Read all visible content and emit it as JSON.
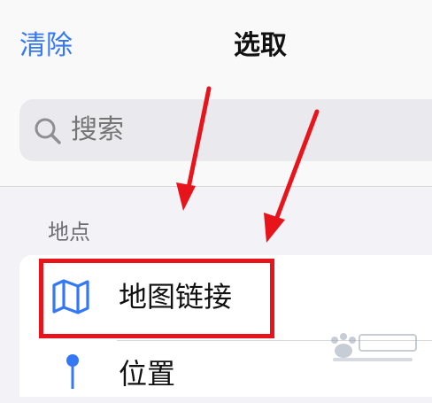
{
  "header": {
    "clear_label": "清除",
    "title": "选取"
  },
  "search": {
    "placeholder": "搜索"
  },
  "section": {
    "title": "地点"
  },
  "list": {
    "items": [
      {
        "label": "地图链接",
        "icon": "map-icon"
      },
      {
        "label": "位置",
        "icon": "location-pin-icon"
      }
    ]
  },
  "annotations": {
    "highlight_color": "#e8141c",
    "accent_color": "#3478f6"
  }
}
